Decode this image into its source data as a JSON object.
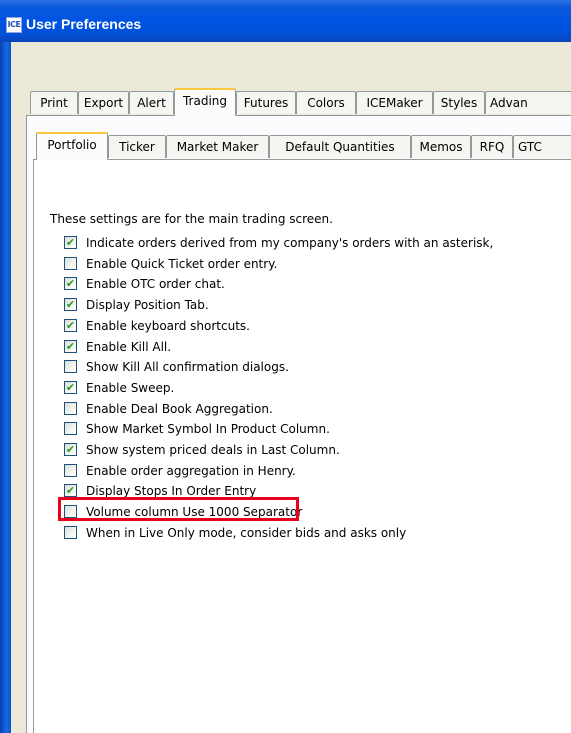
{
  "window": {
    "title": "User Preferences",
    "app_icon_text": "ICE"
  },
  "outer_tabs": [
    "Print",
    "Export",
    "Alert",
    "Trading",
    "Futures",
    "Colors",
    "ICEMaker",
    "Styles",
    "Advan"
  ],
  "outer_tabs_selected": "Trading",
  "inner_tabs": [
    "Portfolio",
    "Ticker",
    "Market Maker",
    "Default Quantities",
    "Memos",
    "RFQ",
    "GTC"
  ],
  "inner_tabs_selected": "Portfolio",
  "intro_text": "These settings are for the main trading screen.",
  "options": [
    {
      "label": "Indicate orders derived from my company's orders with an asterisk,",
      "checked": true
    },
    {
      "label": "Enable Quick Ticket order entry.",
      "checked": false
    },
    {
      "label": "Enable OTC order chat.",
      "checked": true
    },
    {
      "label": "Display Position Tab.",
      "checked": true
    },
    {
      "label": "Enable keyboard shortcuts.",
      "checked": true
    },
    {
      "label": "Enable Kill All.",
      "checked": true
    },
    {
      "label": "Show Kill All confirmation dialogs.",
      "checked": false
    },
    {
      "label": "Enable Sweep.",
      "checked": true
    },
    {
      "label": "Enable Deal Book Aggregation.",
      "checked": false
    },
    {
      "label": "Show Market Symbol In Product Column.",
      "checked": false
    },
    {
      "label": "Show system priced deals in Last Column.",
      "checked": true
    },
    {
      "label": "Enable order aggregation in Henry.",
      "checked": false
    },
    {
      "label": "Display Stops In Order Entry",
      "checked": true
    },
    {
      "label": "Volume column Use 1000 Separator",
      "checked": false
    },
    {
      "label": "When in Live Only mode, consider bids and asks only",
      "checked": false
    }
  ],
  "highlighted_option": "Display Stops In Order Entry",
  "colors": {
    "titlebar": "#0054e3",
    "highlight_border": "#e8001c",
    "checkmark": "#21a121",
    "tab_selected_accent": "#ffc83c"
  }
}
